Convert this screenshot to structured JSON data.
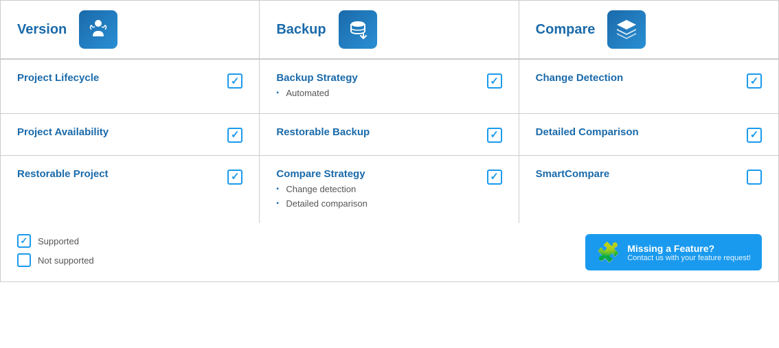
{
  "header": {
    "col1": {
      "label": "Version"
    },
    "col2": {
      "label": "Backup"
    },
    "col3": {
      "label": "Compare"
    }
  },
  "rows": [
    {
      "col1": {
        "title": "Project Lifecycle",
        "subs": [],
        "checked": true
      },
      "col2": {
        "title": "Backup Strategy",
        "subs": [
          "Automated"
        ],
        "checked": true
      },
      "col3": {
        "title": "Change Detection",
        "subs": [],
        "checked": true
      }
    },
    {
      "col1": {
        "title": "Project Availability",
        "subs": [],
        "checked": true
      },
      "col2": {
        "title": "Restorable Backup",
        "subs": [],
        "checked": true
      },
      "col3": {
        "title": "Detailed Comparison",
        "subs": [],
        "checked": true
      }
    },
    {
      "col1": {
        "title": "Restorable Project",
        "subs": [],
        "checked": true
      },
      "col2": {
        "title": "Compare Strategy",
        "subs": [
          "Change detection",
          "Detailed comparison"
        ],
        "checked": true
      },
      "col3": {
        "title": "SmartCompare",
        "subs": [],
        "checked": false
      }
    }
  ],
  "legend": {
    "supported": "Supported",
    "not_supported": "Not supported"
  },
  "missing_feature": {
    "title": "Missing a Feature?",
    "subtitle": "Contact us with your feature request!"
  }
}
